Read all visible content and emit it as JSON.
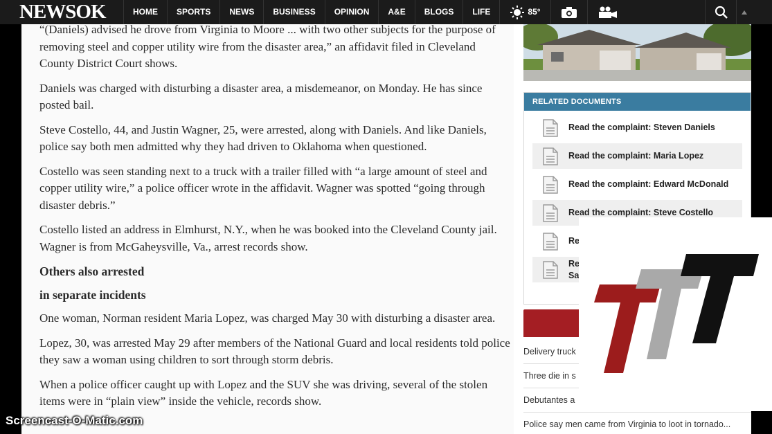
{
  "header": {
    "logo": "NEWSOK",
    "nav": [
      "HOME",
      "SPORTS",
      "NEWS",
      "BUSINESS",
      "OPINION",
      "A&E",
      "BLOGS",
      "LIFE"
    ],
    "weather": "85°"
  },
  "article": {
    "paragraphs_top": [
      "“(Daniels) advised he drove from Virginia to Moore ... with two other subjects for the purpose of removing steel and copper utility wire from the disaster area,” an affidavit filed in Cleveland County District Court shows.",
      "Daniels was charged with disturbing a disaster area, a misdemeanor, on Monday. He has since posted bail.",
      "Steve Costello, 44, and Justin Wagner, 25, were arrested, along with Daniels. And like Daniels, police say both men admitted why they had driven to Oklahoma when questioned.",
      "Costello was seen standing next to a truck with a trailer filled with “a large amount of steel and copper utility wire,” a police officer wrote in the affidavit. Wagner was spotted “going through disaster debris.”",
      "Costello listed an address in Elmhurst, N.Y., when he was booked into the Cleveland County jail. Wagner is from McGaheysville, Va., arrest records show."
    ],
    "subheads": [
      "Others also arrested",
      "in separate incidents"
    ],
    "paragraphs_bottom": [
      "One woman, Norman resident Maria Lopez, was charged May 30 with disturbing a disaster area.",
      "Lopez, 30, was arrested May 29 after members of the National Guard and local residents told police they saw a woman using children to sort through storm debris.",
      "When a police officer caught up with Lopez and the SUV she was driving, several of the stolen items were in “plain view” inside the vehicle, records show."
    ]
  },
  "sidebar": {
    "related_title": "RELATED DOCUMENTS",
    "documents": [
      "Read the complaint: Steven Daniels",
      "Read the complaint: Maria Lopez",
      "Read the complaint: Edward McDonald",
      "Read the complaint: Steve Costello",
      "Re",
      "Re\nSa"
    ],
    "stories": [
      "Delivery truck",
      "Three die in s",
      "Debutantes a",
      "Police say men came from Virginia to loot in tornado..."
    ]
  },
  "watermark": "Screencast-O-Matic.com",
  "colors": {
    "nav_bg": "#1b1b1b",
    "related_header": "#3a7ca0",
    "red_bar": "#a41e23",
    "logo_red": "#9c1c1c",
    "logo_gray": "#a9a9a9",
    "logo_black": "#111111"
  }
}
